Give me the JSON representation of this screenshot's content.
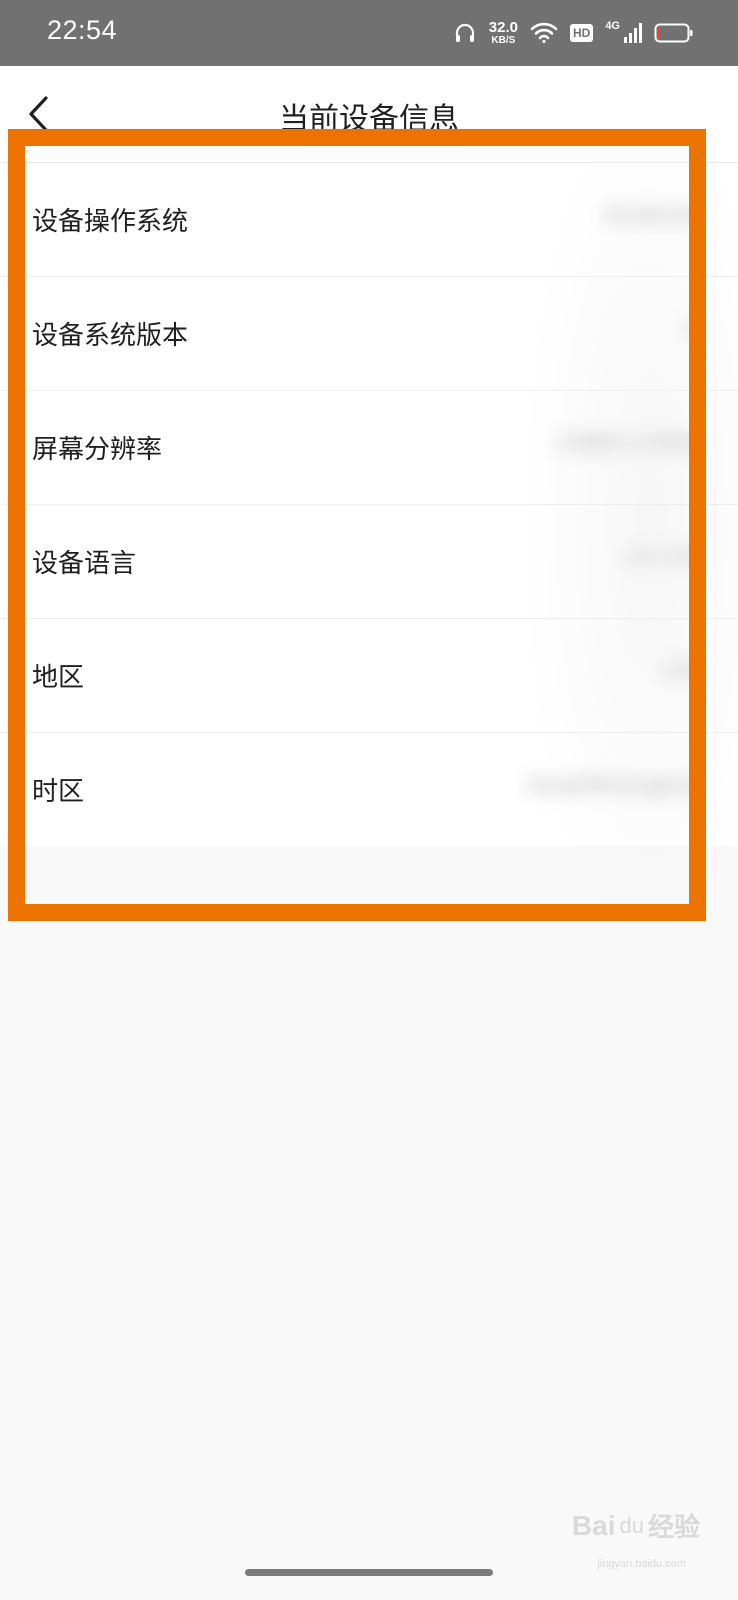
{
  "status_bar": {
    "time": "22:54",
    "net_speed_value": "32.0",
    "net_speed_unit": "KB/S",
    "hd_label": "HD",
    "network_type": "4G",
    "battery_level": 0.08
  },
  "header": {
    "title": "当前设备信息",
    "back_icon": "chevron-left-icon"
  },
  "rows": [
    {
      "label": "设备操作系统",
      "value": "Android"
    },
    {
      "label": "设备系统版本",
      "value": "1"
    },
    {
      "label": "屏幕分辨率",
      "value": "1080×2400"
    },
    {
      "label": "设备语言",
      "value": "zh-CN"
    },
    {
      "label": "地区",
      "value": "CN"
    },
    {
      "label": "时区",
      "value": "Asia/Shanghai"
    }
  ],
  "annotation": {
    "frame_color": "#ec7300"
  },
  "watermark": {
    "brand": "Bai",
    "paw": "du",
    "cn": "经验",
    "url": "jingyan.baidu.com"
  }
}
